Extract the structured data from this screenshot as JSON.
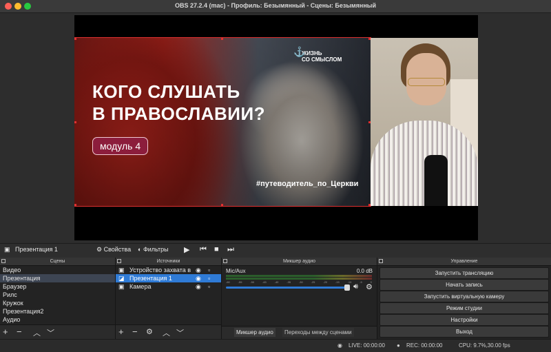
{
  "window": {
    "title": "OBS 27.2.4 (mac) - Профиль: Безымянный - Сцены: Безымянный"
  },
  "colors": {
    "selection": "#2f7bd6",
    "bounding_box": "#e03030",
    "badge": "#8c1d3c"
  },
  "preview": {
    "slide_title_line1": "КОГО СЛУШАТЬ",
    "slide_title_line2": "В ПРАВОСЛАВИИ?",
    "slide_badge": "модуль 4",
    "slide_brand_line1": "ЖИЗНЬ",
    "slide_brand_line2": "СО СМЫСЛОМ",
    "slide_hashtag": "#путеводитель_по_Церкви"
  },
  "toolbar": {
    "current_source": "Презентация 1",
    "properties_label": "Свойства",
    "filters_label": "Фильтры"
  },
  "scenes": {
    "title": "Сцены",
    "items": [
      "Видео",
      "Презентация",
      "Браузер",
      "Рилс",
      "Кружок",
      "Презентация2",
      "Аудио"
    ],
    "selected": "Презентация"
  },
  "sources": {
    "title": "Источники",
    "items": [
      {
        "label": "Устройство захвата в",
        "icon": "camera-icon"
      },
      {
        "label": "Презентация 1",
        "icon": "window-capture-icon"
      },
      {
        "label": "Камера",
        "icon": "camera-icon"
      }
    ],
    "selected": "Презентация 1"
  },
  "mixer": {
    "title": "Микшер аудио",
    "channel_name": "Mic/Aux",
    "channel_db": "0.0 dB",
    "scale": [
      "-60",
      "-55",
      "-50",
      "-45",
      "-40",
      "-35",
      "-30",
      "-25",
      "-20",
      "-15",
      "-10",
      "-5",
      "0"
    ],
    "tab_active": "Микшер аудио",
    "tab_inactive": "Переходы между сценами"
  },
  "controls": {
    "title": "Управление",
    "buttons": [
      "Запустить трансляцию",
      "Начать запись",
      "Запустить виртуальную камеру",
      "Режим студии",
      "Настройки",
      "Выход"
    ]
  },
  "status": {
    "live": "LIVE: 00:00:00",
    "rec": "REC: 00:00:00",
    "cpu": "CPU: 9.7%,30.00 fps"
  }
}
